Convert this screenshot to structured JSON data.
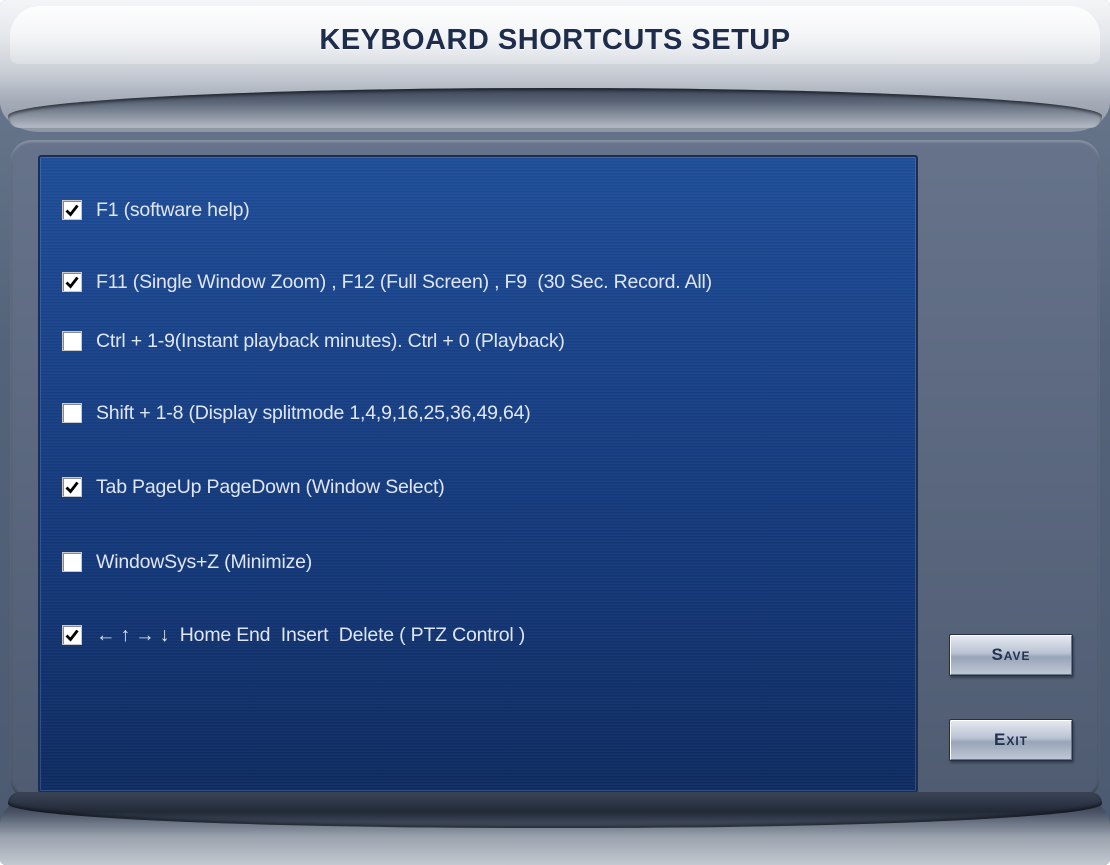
{
  "window": {
    "title": "KEYBOARD SHORTCUTS SETUP"
  },
  "shortcuts": [
    {
      "label": "F1 (software help)",
      "checked": true
    },
    {
      "label": "F11 (Single Window Zoom) , F12 (Full Screen) , F9  (30 Sec. Record. All)",
      "checked": true
    },
    {
      "label": "Ctrl + 1-9(Instant playback minutes). Ctrl + 0 (Playback)",
      "checked": false
    },
    {
      "label": "Shift + 1-8 (Display splitmode 1,4,9,16,25,36,49,64)",
      "checked": false
    },
    {
      "label": "Tab PageUp PageDown (Window Select)",
      "checked": true
    },
    {
      "label": "WindowSys+Z (Minimize)",
      "checked": false
    },
    {
      "label": "← ↑ → ↓  Home End  Insert  Delete ( PTZ Control )",
      "checked": true
    }
  ],
  "buttons": {
    "save_label": "Save",
    "exit_label": "Exit"
  },
  "colors": {
    "panel": "#1a438a",
    "title_text": "#1f2d4d",
    "option_text": "#dfe6f2"
  }
}
